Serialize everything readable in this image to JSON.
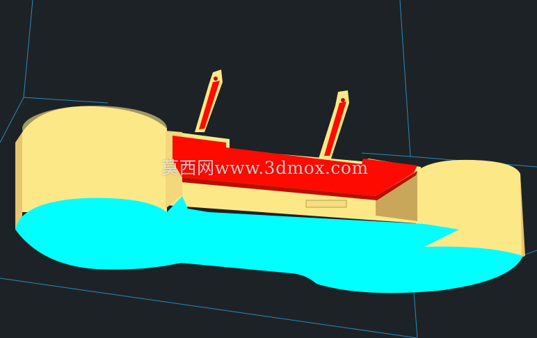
{
  "scene": {
    "background_color": "#1d2226",
    "grid_line_color": "#2a9fd6",
    "colors": {
      "body_yellow": "#fde888",
      "body_shade": "#e6c66f",
      "body_dark": "#c9a75a",
      "cap_cyan": "#00ffff",
      "recess_red": "#ff0a00",
      "recess_red_dark": "#b81000"
    }
  },
  "watermark": {
    "text": "莫西网www.3dmox.com"
  }
}
